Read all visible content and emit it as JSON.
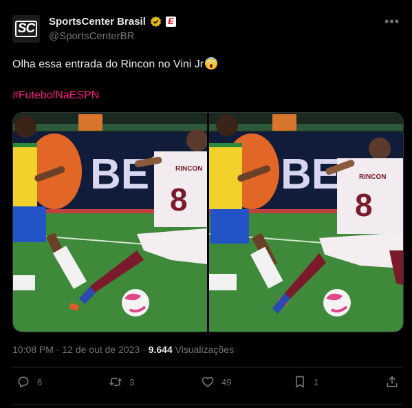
{
  "account": {
    "display_name": "SportsCenter Brasil",
    "handle": "@SportsCenterBR",
    "avatar_text": "SC",
    "badge_letter": "E"
  },
  "post": {
    "text": "Olha essa entrada do Rincon no Vini Jr",
    "hashtag": "#FutebolNaESPN",
    "timestamp": "10:08 PM · 12 de out de 2023 · ",
    "views_count": "9.644",
    "views_label": " Visualizações"
  },
  "media": {
    "left_photo": {
      "board_text": "BET",
      "shirt_name": "RINCON",
      "shirt_number": "8"
    },
    "right_photo": {
      "board_text": "BET",
      "shirt_name": "RINCON",
      "shirt_number": "8"
    }
  },
  "actions": {
    "replies": "6",
    "reposts": "3",
    "likes": "49",
    "bookmarks": "1"
  },
  "colors": {
    "background": "#000000",
    "text": "#e7e9ea",
    "secondary": "#71767b",
    "hashtag": "#f91880",
    "border": "#2f3336"
  }
}
